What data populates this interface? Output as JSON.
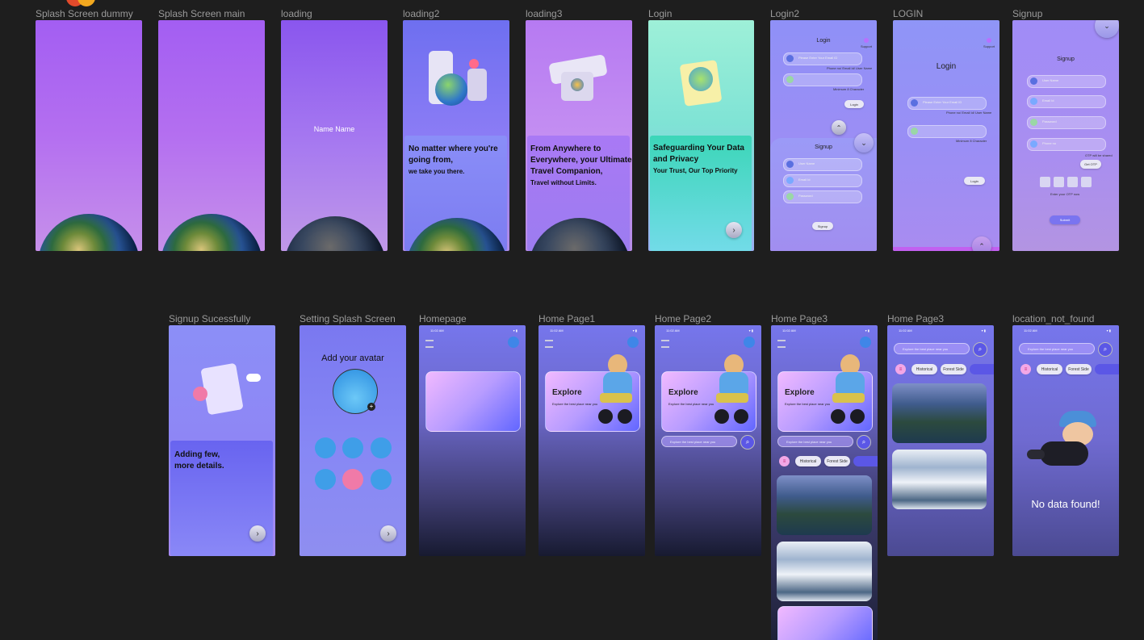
{
  "frames": {
    "splash_dummy": {
      "label": "Splash Screen dummy"
    },
    "splash_main": {
      "label": "Splash Screen main"
    },
    "loading": {
      "label": "loading",
      "text": "Name Name"
    },
    "loading2": {
      "label": "loading2",
      "line1": "No matter where you're",
      "line2": "going from,",
      "line3": "we take you there."
    },
    "loading3": {
      "label": "loading3",
      "line1": "From Anywhere to",
      "line2": "Everywhere, your Ultimate",
      "line3": "Travel Companion,",
      "line4": "Travel without Limits."
    },
    "login": {
      "label": "Login",
      "line1": "Safeguarding Your Data",
      "line2": "and Privacy",
      "line3": "Your Trust, Our Top Priority"
    },
    "login2": {
      "label": "Login2",
      "title": "Login",
      "support": "Support",
      "email_ph": "Please Enter Your Email ID",
      "email_hint": "Phone no/ Email Id/ User Name",
      "password_hint": "Minimum 8 Character",
      "login_btn": "Login",
      "signup_title": "Signup",
      "user_name": "User Name",
      "email": "Email Id",
      "password": "Password",
      "signup_btn": "Signup"
    },
    "login_caps": {
      "label": "LOGIN",
      "title": "Login",
      "support": "Support",
      "email_ph": "Please Enter Your Email ID",
      "email_hint": "Phone no/ Email Id/ User Name",
      "password_hint": "Minimum 8 Character",
      "login_btn": "Login"
    },
    "signup": {
      "label": "Signup",
      "title": "Signup",
      "user_name": "User Name",
      "email": "Email Id",
      "password": "Password",
      "phone": "Phone no",
      "otp_note": "OTP will be shared",
      "get_otp": "Get OTP",
      "otp_hint": "Enter your OTP now",
      "submit": "Submit"
    },
    "signup_success": {
      "label": "Signup Sucessfully",
      "line1": "Adding few,",
      "line2": "more details."
    },
    "setting_splash": {
      "label": "Setting Splash Screen",
      "title": "Add your avatar"
    },
    "homepage": {
      "label": "Homepage",
      "time": "11:02 AM"
    },
    "home1": {
      "label": "Home Page1",
      "time": "11:02 AM",
      "explore": "Explore",
      "explore_sub": "Explore the best place near you"
    },
    "home2": {
      "label": "Home Page2",
      "time": "11:02 AM",
      "explore": "Explore",
      "explore_sub": "Explore the best place near you",
      "search_ph": "Explore the best place near you"
    },
    "home3": {
      "label": "Home Page3",
      "time": "11:02 AM",
      "explore": "Explore",
      "explore_sub": "Explore the best place near you",
      "search_ph": "Explore the best place near you",
      "chip1": "Historical",
      "chip2": "Forest Side"
    },
    "home3b": {
      "label": "Home Page3",
      "time": "11:02 AM",
      "search_ph": "Explore the best place near you",
      "chip1": "Historical",
      "chip2": "Forest Side"
    },
    "not_found": {
      "label": "location_not_found",
      "time": "11:02 AM",
      "search_ph": "Explore the best place near you",
      "chip1": "Historical",
      "chip2": "Forest Side",
      "message": "No data found!"
    }
  },
  "colors": {
    "canvas": "#1e1e1e",
    "label": "#9a9a9a",
    "purple": "#a864f0",
    "accent": "#5b57e6"
  }
}
